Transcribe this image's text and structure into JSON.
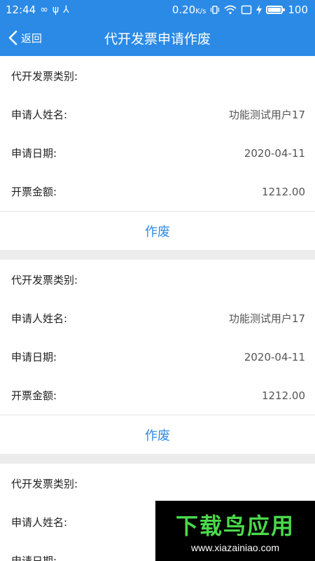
{
  "status": {
    "time": "12:44",
    "left_icons": [
      "∞",
      "ψ",
      "⅄"
    ],
    "speed": "0.20",
    "speed_unit": "K/s",
    "battery_level": "100"
  },
  "nav": {
    "back_label": "返回",
    "title": "代开发票申请作废"
  },
  "labels": {
    "invoice_type": "代开发票类别:",
    "applicant": "申请人姓名:",
    "date": "申请日期:",
    "amount": "开票金额:"
  },
  "records": [
    {
      "type_value": "",
      "applicant": "功能测试用户17",
      "date": "2020-04-11",
      "amount": "1212.00",
      "void_label": "作废"
    },
    {
      "type_value": "",
      "applicant": "功能测试用户17",
      "date": "2020-04-11",
      "amount": "1212.00",
      "void_label": "作废"
    },
    {
      "type_value": "",
      "applicant": "",
      "date": "",
      "amount": "",
      "void_label": ""
    }
  ],
  "watermark": {
    "title": "下载鸟应用",
    "url": "www.xiazainiao.com"
  },
  "colors": {
    "primary": "#2b8ae6",
    "background": "#ececec"
  }
}
